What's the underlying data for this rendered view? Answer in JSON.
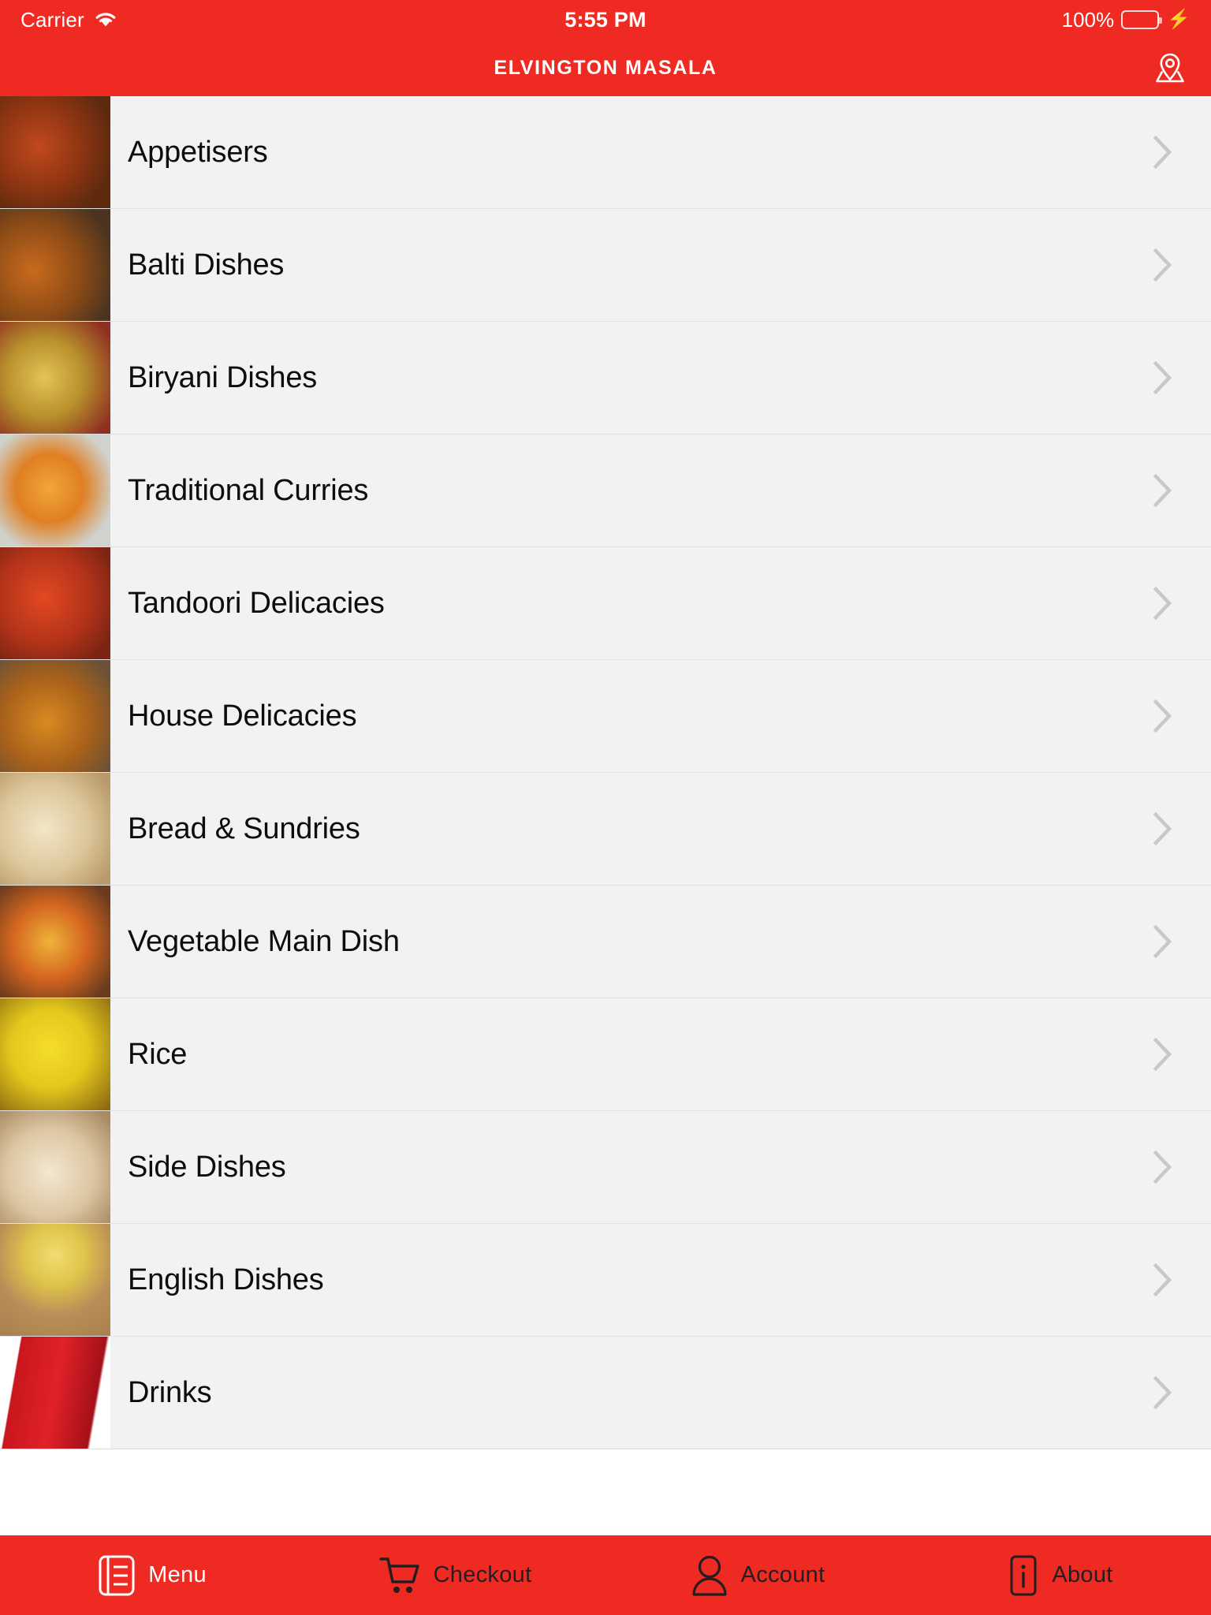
{
  "status_bar": {
    "carrier": "Carrier",
    "wifi_icon": "wifi-icon",
    "time": "5:55 PM",
    "battery_percent": "100%",
    "battery_icon": "battery-full-icon",
    "charging_icon": "lightning-bolt-icon"
  },
  "nav_bar": {
    "title": "ELVINGTON MASALA",
    "right_icon": "map-location-pin-icon"
  },
  "menu": {
    "chevron_icon": "chevron-right-icon",
    "categories": [
      {
        "label": "Appetisers",
        "thumb": "onion-bhaji-photo"
      },
      {
        "label": "Balti Dishes",
        "thumb": "balti-curry-photo"
      },
      {
        "label": "Biryani Dishes",
        "thumb": "biryani-rice-photo"
      },
      {
        "label": "Traditional Curries",
        "thumb": "curry-bowl-photo"
      },
      {
        "label": "Tandoori Delicacies",
        "thumb": "tandoori-chicken-photo"
      },
      {
        "label": "House Delicacies",
        "thumb": "house-curry-photo"
      },
      {
        "label": "Bread & Sundries",
        "thumb": "naan-bread-photo"
      },
      {
        "label": "Vegetable Main Dish",
        "thumb": "vegetable-curry-photo"
      },
      {
        "label": "Rice",
        "thumb": "pilau-rice-photo"
      },
      {
        "label": "Side Dishes",
        "thumb": "poppadoms-photo"
      },
      {
        "label": "English Dishes",
        "thumb": "chips-photo"
      },
      {
        "label": "Drinks",
        "thumb": "coca-cola-can-photo"
      }
    ]
  },
  "tab_bar": {
    "tabs": [
      {
        "label": "Menu",
        "icon": "menu-book-icon",
        "active": true
      },
      {
        "label": "Checkout",
        "icon": "shopping-cart-icon",
        "active": false
      },
      {
        "label": "Account",
        "icon": "person-icon",
        "active": false
      },
      {
        "label": "About",
        "icon": "info-icon",
        "active": false
      }
    ]
  },
  "colors": {
    "brand_red": "#ee2a23",
    "list_background": "#f2f2f2",
    "row_text": "#0d0d0d",
    "chevron": "#c7c7cc",
    "inactive_tab": "#231f20",
    "active_tab": "#ffffff",
    "battery_green": "#4cd964"
  }
}
